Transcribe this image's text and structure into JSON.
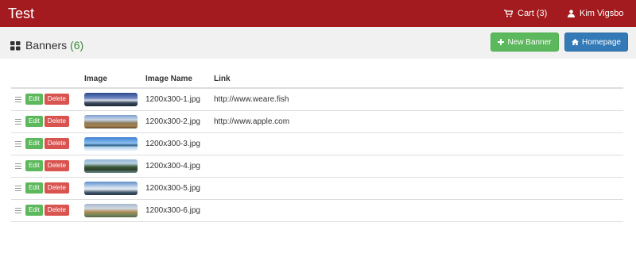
{
  "navbar": {
    "brand": "Test",
    "cart_label": "Cart (3)",
    "user_label": "Kim Vigsbo",
    "background": "#a31b1e"
  },
  "header": {
    "title": "Banners",
    "count": "(6)",
    "new_banner_label": "New Banner",
    "homepage_label": "Homepage"
  },
  "table": {
    "columns": [
      "",
      "Image",
      "Image Name",
      "Link"
    ],
    "edit_label": "Edit",
    "delete_label": "Delete",
    "rows": [
      {
        "name": "1200x300-1.jpg",
        "link": "http://www.weare.fish"
      },
      {
        "name": "1200x300-2.jpg",
        "link": "http://www.apple.com"
      },
      {
        "name": "1200x300-3.jpg",
        "link": ""
      },
      {
        "name": "1200x300-4.jpg",
        "link": ""
      },
      {
        "name": "1200x300-5.jpg",
        "link": ""
      },
      {
        "name": "1200x300-6.jpg",
        "link": ""
      }
    ]
  },
  "colors": {
    "success": "#5cb85c",
    "primary": "#337ab7",
    "danger": "#d9534f",
    "count": "#3a8a3a"
  },
  "icons": {
    "cart": "cart-icon",
    "user": "user-icon",
    "title": "grid-icon",
    "new": "plus-icon",
    "home": "home-icon",
    "drag": "drag-handle-icon"
  }
}
